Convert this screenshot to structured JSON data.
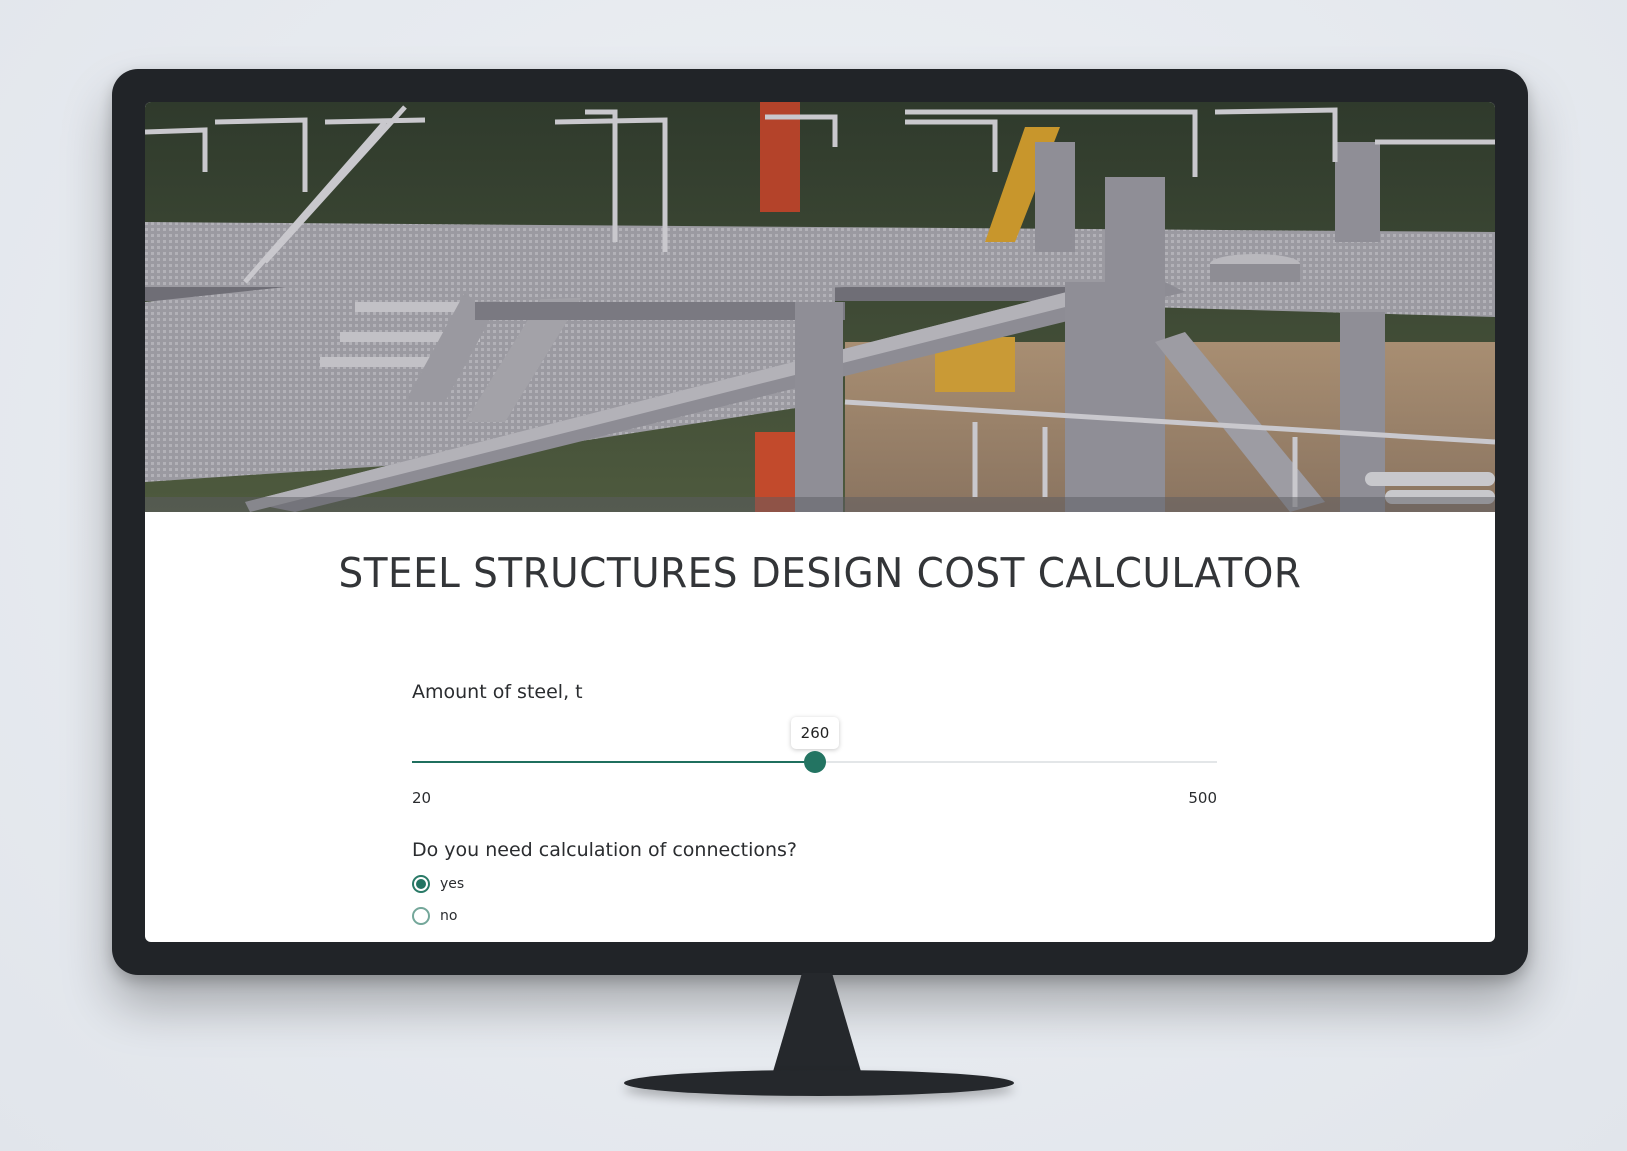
{
  "page": {
    "title": "STEEL STRUCTURES DESIGN COST CALCULATOR"
  },
  "hero_image": {
    "subject": "steel platform structure with stairs and railings at construction site"
  },
  "steel_amount": {
    "label": "Amount of steel, t",
    "value": "260",
    "min": "20",
    "max": "500",
    "fill_fraction": 0.5
  },
  "connections": {
    "question": "Do you need calculation of connections?",
    "options": [
      {
        "label": "yes",
        "selected": true
      },
      {
        "label": "no",
        "selected": false
      }
    ]
  },
  "colors": {
    "accent": "#237462",
    "monitor_bezel": "#212428",
    "title_text": "#333538"
  }
}
